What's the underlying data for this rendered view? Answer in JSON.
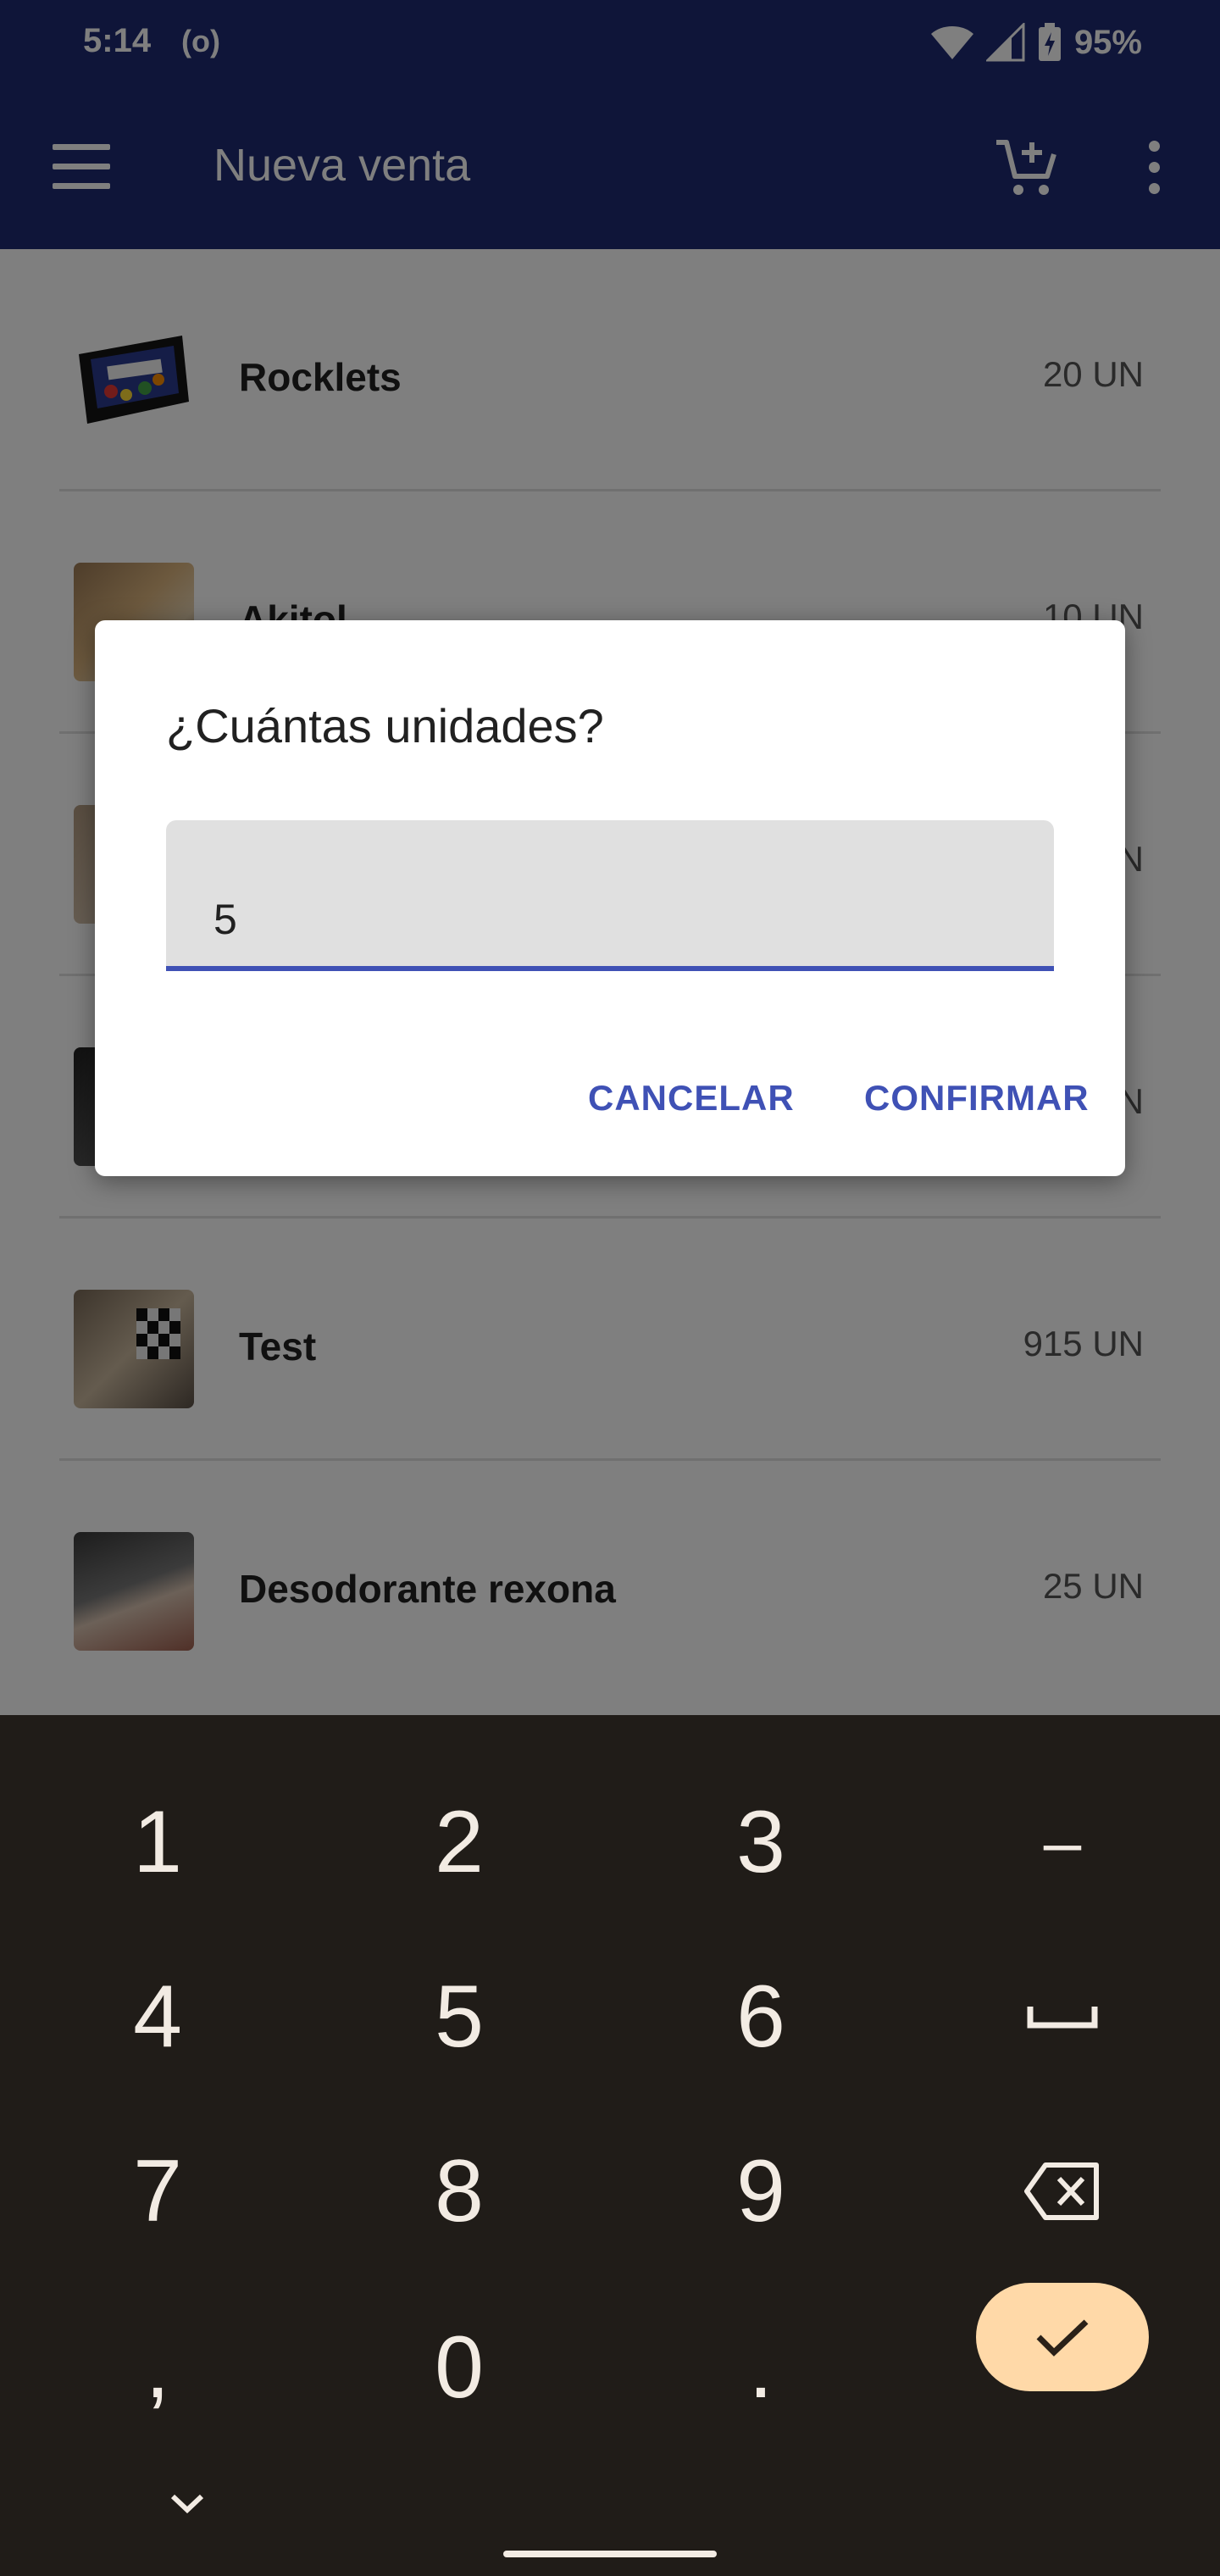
{
  "status_bar": {
    "time": "5:14",
    "cast": "(o)",
    "battery": "95%"
  },
  "app_bar": {
    "title": "Nueva venta",
    "menu_icon": "menu-icon",
    "cart_icon": "add-cart-icon",
    "overflow_icon": "more-vert-icon"
  },
  "products": [
    {
      "name": "Rocklets",
      "qty": "20 UN"
    },
    {
      "name": "Akitol",
      "qty": "10 UN"
    },
    {
      "name": "",
      "qty": "UN"
    },
    {
      "name": "",
      "qty": "UN"
    },
    {
      "name": "Test",
      "qty": "915 UN"
    },
    {
      "name": "Desodorante rexona",
      "qty": "25 UN"
    }
  ],
  "dialog": {
    "title": "¿Cuántas unidades?",
    "input_value": "5",
    "cancel_label": "CANCELAR",
    "confirm_label": "CONFIRMAR"
  },
  "keyboard": {
    "keys": [
      "1",
      "2",
      "3",
      "–",
      "4",
      "5",
      "6",
      "space",
      "7",
      "8",
      "9",
      "backspace",
      ",",
      "0",
      ".",
      "enter"
    ],
    "collapse_icon": "chevron-down-icon"
  },
  "colors": {
    "primary": "#1e2a73",
    "accent": "#3f51b5",
    "keyboard_bg": "#201c18",
    "enter_key": "#ffd9a8"
  }
}
